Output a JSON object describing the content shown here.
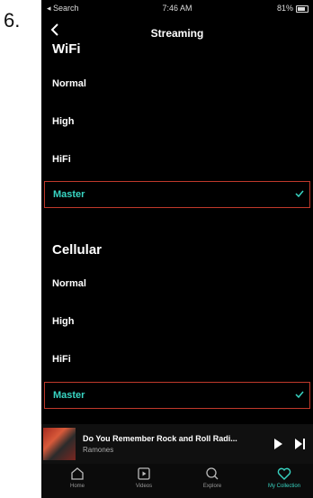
{
  "step_number": "6.",
  "status_bar": {
    "back_app": "◂ Search",
    "time": "7:46 AM",
    "battery": "81%"
  },
  "nav": {
    "title": "Streaming"
  },
  "wifi": {
    "title": "WiFi",
    "options": [
      {
        "label": "Normal",
        "selected": false
      },
      {
        "label": "High",
        "selected": false
      },
      {
        "label": "HiFi",
        "selected": false
      },
      {
        "label": "Master",
        "selected": true
      }
    ]
  },
  "cellular": {
    "title": "Cellular",
    "options": [
      {
        "label": "Normal",
        "selected": false
      },
      {
        "label": "High",
        "selected": false
      },
      {
        "label": "HiFi",
        "selected": false
      },
      {
        "label": "Master",
        "selected": true
      }
    ]
  },
  "now_playing": {
    "track": "Do You Remember Rock and Roll Radi...",
    "artist": "Ramones"
  },
  "tabs": [
    {
      "label": "Home",
      "icon": "home-icon",
      "active": false
    },
    {
      "label": "Videos",
      "icon": "videos-icon",
      "active": false
    },
    {
      "label": "Explore",
      "icon": "search-icon",
      "active": false
    },
    {
      "label": "My Collection",
      "icon": "heart-icon",
      "active": true
    }
  ],
  "colors": {
    "accent": "#38d4c2",
    "highlight_border": "#c0392b",
    "background": "#000000"
  }
}
